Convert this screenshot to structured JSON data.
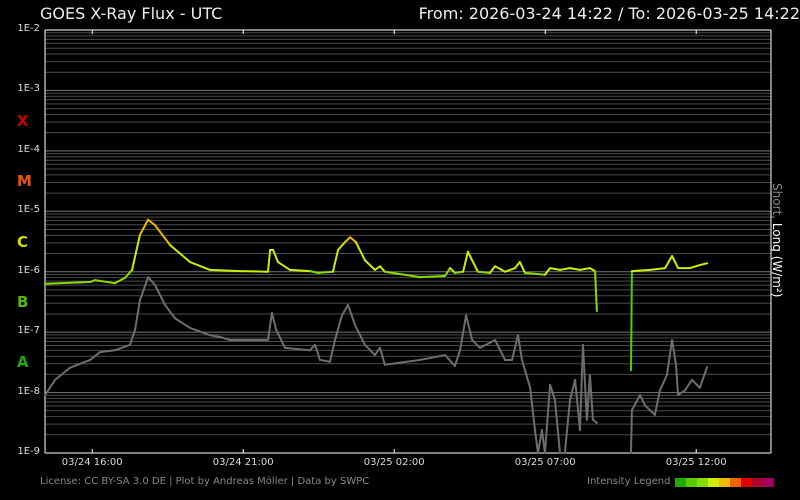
{
  "header": {
    "title": "GOES X-Ray Flux - UTC",
    "range": "From: 2026-03-24 14:22  /  To: 2026-03-25 14:22"
  },
  "footer": {
    "license": "License: CC BY-SA 3.0 DE | Plot by Andreas Möller | Data by SWPC",
    "legend_label": "Intensity Legend"
  },
  "legend_colors": [
    "#22aa00",
    "#55cc00",
    "#88dd00",
    "#ccee00",
    "#f0b800",
    "#ee6600",
    "#e00000",
    "#b00030",
    "#a00060"
  ],
  "chart_data": {
    "type": "line",
    "title": "GOES X-Ray Flux - UTC",
    "x_unit": "hours since 2026-03-24 14:22 UTC",
    "ylabel_short": "Short,",
    "ylabel_long": "Long (W/m²)",
    "yscale": "log",
    "ylim_exp": [
      -9,
      -2
    ],
    "ytick_labels": [
      "1E-2",
      "1E-3",
      "1E-4",
      "1E-5",
      "1E-6",
      "1E-7",
      "1E-8",
      "1E-9"
    ],
    "classes": [
      {
        "label": "X",
        "exp": -3.5,
        "color": "#cc0000"
      },
      {
        "label": "M",
        "exp": -4.5,
        "color": "#ee5500"
      },
      {
        "label": "C",
        "exp": -5.5,
        "color": "#dddd00"
      },
      {
        "label": "B",
        "exp": -6.5,
        "color": "#55bb00"
      },
      {
        "label": "A",
        "exp": -7.5,
        "color": "#22aa00"
      }
    ],
    "xticks": [
      {
        "label": "03/24 16:00",
        "h": 1.63
      },
      {
        "label": "03/24 21:00",
        "h": 6.63
      },
      {
        "label": "03/25 02:00",
        "h": 11.63
      },
      {
        "label": "03/25 07:00",
        "h": 16.63
      },
      {
        "label": "03/25 12:00",
        "h": 21.63
      }
    ],
    "grid": true,
    "series": [
      {
        "name": "Long",
        "color_mode": "intensity",
        "segments": [
          [
            [
              0.07,
              -6.2
            ],
            [
              1.56,
              -6.17
            ],
            [
              1.72,
              -6.14
            ],
            [
              2.38,
              -6.19
            ],
            [
              2.72,
              -6.1
            ],
            [
              2.95,
              -5.97
            ],
            [
              3.21,
              -5.39
            ],
            [
              3.48,
              -5.14
            ],
            [
              3.71,
              -5.23
            ],
            [
              4.21,
              -5.56
            ],
            [
              4.87,
              -5.84
            ],
            [
              5.53,
              -5.97
            ],
            [
              6.52,
              -5.99
            ],
            [
              7.45,
              -6.0
            ],
            [
              7.52,
              -5.64
            ],
            [
              7.62,
              -5.64
            ],
            [
              7.78,
              -5.84
            ],
            [
              8.18,
              -5.97
            ],
            [
              8.84,
              -5.99
            ],
            [
              9.11,
              -6.02
            ],
            [
              9.6,
              -6.0
            ],
            [
              9.77,
              -5.64
            ],
            [
              10.0,
              -5.51
            ],
            [
              10.17,
              -5.43
            ],
            [
              10.36,
              -5.51
            ],
            [
              10.66,
              -5.81
            ],
            [
              10.99,
              -5.97
            ],
            [
              11.16,
              -5.91
            ],
            [
              11.32,
              -6.0
            ],
            [
              12.48,
              -6.09
            ],
            [
              13.31,
              -6.07
            ],
            [
              13.48,
              -5.94
            ],
            [
              13.64,
              -6.02
            ],
            [
              13.91,
              -6.0
            ],
            [
              14.07,
              -5.67
            ],
            [
              14.21,
              -5.81
            ],
            [
              14.4,
              -6.0
            ],
            [
              14.8,
              -6.02
            ],
            [
              14.97,
              -5.91
            ],
            [
              15.3,
              -6.0
            ],
            [
              15.63,
              -5.94
            ],
            [
              15.79,
              -5.84
            ],
            [
              15.96,
              -6.02
            ],
            [
              16.62,
              -6.05
            ],
            [
              16.79,
              -5.94
            ],
            [
              17.12,
              -5.97
            ],
            [
              17.45,
              -5.94
            ],
            [
              17.78,
              -5.97
            ],
            [
              18.11,
              -5.94
            ],
            [
              18.28,
              -5.99
            ],
            [
              18.34,
              -6.65
            ]
          ],
          [
            [
              19.47,
              -7.63
            ],
            [
              19.5,
              -5.99
            ],
            [
              20.1,
              -5.97
            ],
            [
              20.6,
              -5.94
            ],
            [
              20.83,
              -5.74
            ],
            [
              21.03,
              -5.94
            ],
            [
              21.42,
              -5.94
            ],
            [
              21.75,
              -5.89
            ],
            [
              21.99,
              -5.86
            ]
          ]
        ]
      },
      {
        "name": "Short",
        "color": "#6e6e6e",
        "segments": [
          [
            [
              0.07,
              -8.04
            ],
            [
              0.4,
              -7.79
            ],
            [
              0.89,
              -7.59
            ],
            [
              1.56,
              -7.46
            ],
            [
              1.89,
              -7.33
            ],
            [
              2.38,
              -7.3
            ],
            [
              2.88,
              -7.21
            ],
            [
              3.05,
              -6.96
            ],
            [
              3.21,
              -6.47
            ],
            [
              3.48,
              -6.09
            ],
            [
              3.71,
              -6.22
            ],
            [
              4.04,
              -6.55
            ],
            [
              4.37,
              -6.77
            ],
            [
              4.87,
              -6.93
            ],
            [
              5.53,
              -7.05
            ],
            [
              5.86,
              -7.08
            ],
            [
              6.19,
              -7.13
            ],
            [
              7.45,
              -7.13
            ],
            [
              7.58,
              -6.68
            ],
            [
              7.72,
              -6.96
            ],
            [
              8.01,
              -7.26
            ],
            [
              8.84,
              -7.3
            ],
            [
              9.01,
              -7.21
            ],
            [
              9.17,
              -7.46
            ],
            [
              9.5,
              -7.49
            ],
            [
              9.67,
              -7.13
            ],
            [
              9.9,
              -6.72
            ],
            [
              10.1,
              -6.55
            ],
            [
              10.33,
              -6.88
            ],
            [
              10.66,
              -7.21
            ],
            [
              10.99,
              -7.38
            ],
            [
              11.16,
              -7.26
            ],
            [
              11.32,
              -7.54
            ],
            [
              12.48,
              -7.46
            ],
            [
              13.31,
              -7.38
            ],
            [
              13.64,
              -7.56
            ],
            [
              13.81,
              -7.3
            ],
            [
              14.01,
              -6.72
            ],
            [
              14.21,
              -7.13
            ],
            [
              14.47,
              -7.26
            ],
            [
              14.97,
              -7.13
            ],
            [
              15.3,
              -7.46
            ],
            [
              15.53,
              -7.46
            ],
            [
              15.73,
              -7.05
            ],
            [
              15.86,
              -7.46
            ],
            [
              16.13,
              -7.92
            ],
            [
              16.29,
              -8.62
            ],
            [
              16.39,
              -9.0
            ],
            [
              16.52,
              -8.62
            ],
            [
              16.62,
              -9.0
            ],
            [
              16.79,
              -7.87
            ],
            [
              16.95,
              -8.12
            ],
            [
              17.12,
              -9.0
            ],
            [
              17.28,
              -9.0
            ],
            [
              17.45,
              -8.12
            ],
            [
              17.62,
              -7.79
            ],
            [
              17.78,
              -8.62
            ],
            [
              17.88,
              -7.21
            ],
            [
              18.01,
              -8.45
            ],
            [
              18.11,
              -7.71
            ],
            [
              18.21,
              -8.45
            ],
            [
              18.34,
              -8.5
            ]
          ],
          [
            [
              19.47,
              -9.0
            ],
            [
              19.5,
              -8.29
            ],
            [
              19.77,
              -8.04
            ],
            [
              19.93,
              -8.21
            ],
            [
              20.26,
              -8.37
            ],
            [
              20.43,
              -7.96
            ],
            [
              20.66,
              -7.71
            ],
            [
              20.83,
              -7.13
            ],
            [
              20.96,
              -7.54
            ],
            [
              21.03,
              -8.04
            ],
            [
              21.26,
              -7.96
            ],
            [
              21.49,
              -7.79
            ],
            [
              21.75,
              -7.92
            ],
            [
              21.99,
              -7.58
            ]
          ]
        ]
      }
    ]
  }
}
